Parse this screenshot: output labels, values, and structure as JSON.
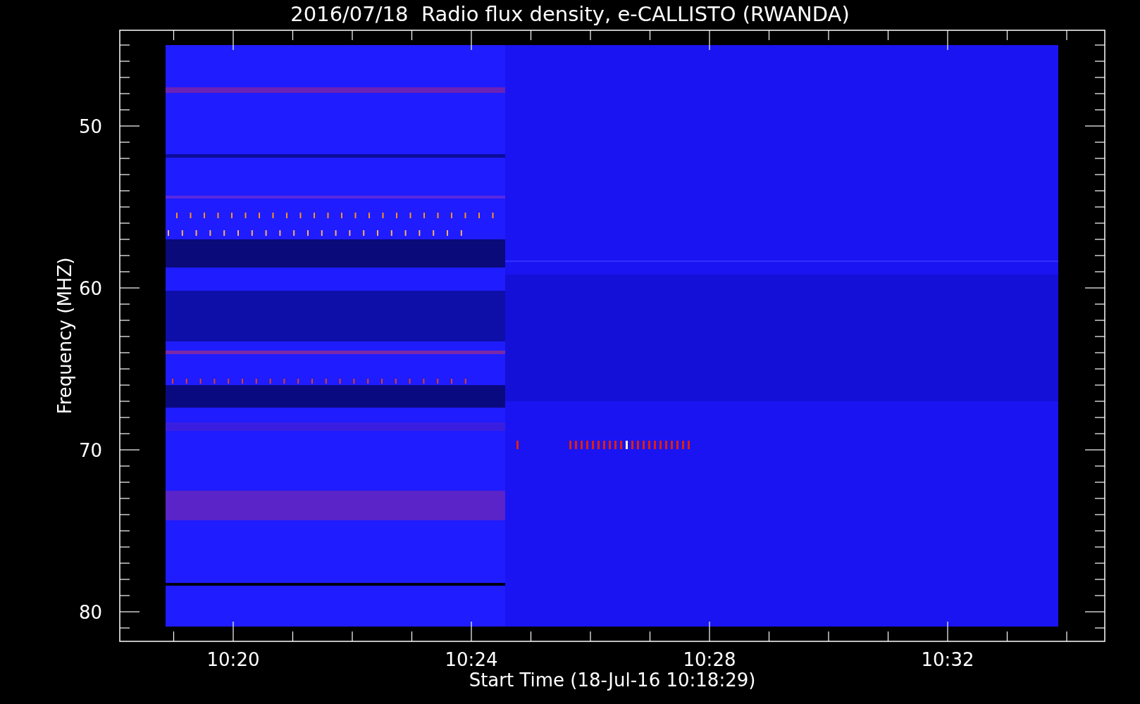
{
  "title": "2016/07/18  Radio flux density, e-CALLISTO (RWANDA)",
  "plot": {
    "ylabel": "Frequency (MHZ)",
    "xlabel": "Start Time (18-Jul-16 10:18:29)",
    "yticks": [
      "50",
      "60",
      "70",
      "80"
    ],
    "xticks": [
      "10:20",
      "10:24",
      "10:28",
      "10:32"
    ]
  }
}
